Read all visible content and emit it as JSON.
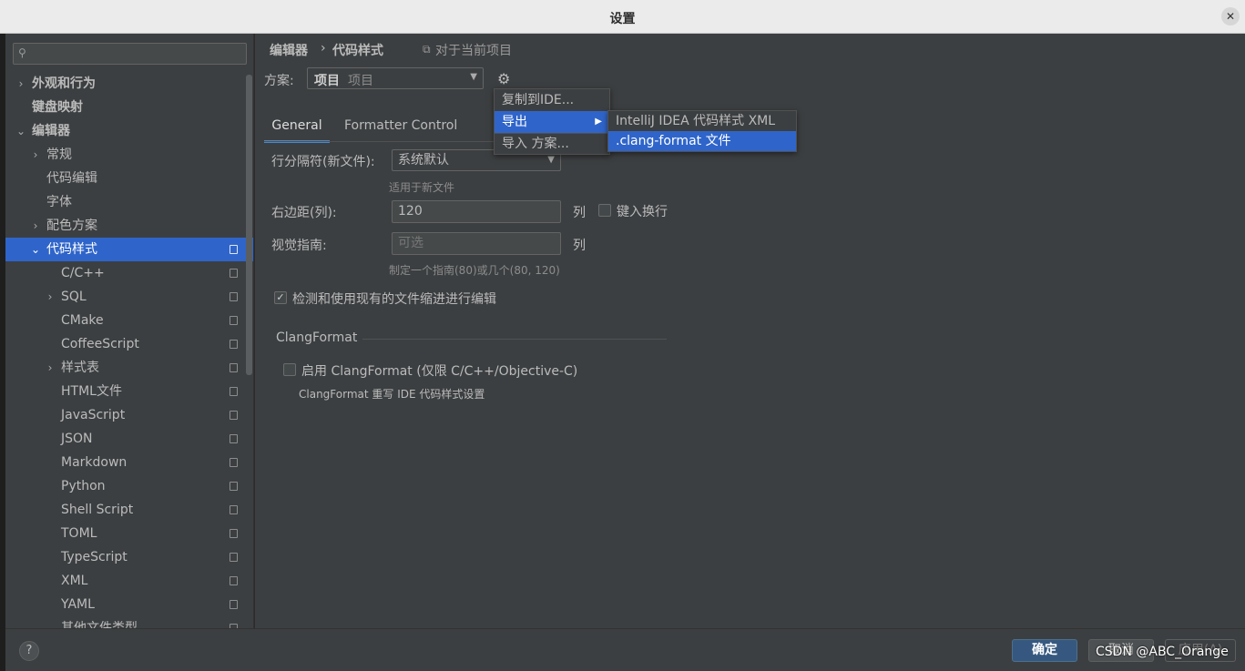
{
  "window": {
    "title": "设置",
    "close_icon": "close-icon"
  },
  "sidebar": {
    "search_placeholder": "",
    "items": [
      {
        "label": "外观和行为",
        "arrow": "›",
        "bold": true
      },
      {
        "label": "键盘映射",
        "arrow": "",
        "bold": true
      },
      {
        "label": "编辑器",
        "arrow": "⌄",
        "bold": true
      },
      {
        "label": "常规",
        "arrow": "›"
      },
      {
        "label": "代码编辑",
        "arrow": ""
      },
      {
        "label": "字体",
        "arrow": ""
      },
      {
        "label": "配色方案",
        "arrow": "›"
      },
      {
        "label": "代码样式",
        "arrow": "⌄",
        "selected": true
      },
      {
        "label": "C/C++",
        "arrow": ""
      },
      {
        "label": "SQL",
        "arrow": "›"
      },
      {
        "label": "CMake",
        "arrow": ""
      },
      {
        "label": "CoffeeScript",
        "arrow": ""
      },
      {
        "label": "样式表",
        "arrow": "›"
      },
      {
        "label": "HTML文件",
        "arrow": ""
      },
      {
        "label": "JavaScript",
        "arrow": ""
      },
      {
        "label": "JSON",
        "arrow": ""
      },
      {
        "label": "Markdown",
        "arrow": ""
      },
      {
        "label": "Python",
        "arrow": ""
      },
      {
        "label": "Shell Script",
        "arrow": ""
      },
      {
        "label": "TOML",
        "arrow": ""
      },
      {
        "label": "TypeScript",
        "arrow": ""
      },
      {
        "label": "XML",
        "arrow": ""
      },
      {
        "label": "YAML",
        "arrow": ""
      },
      {
        "label": "其他文件类型",
        "arrow": ""
      }
    ]
  },
  "breadcrumb": {
    "root": "编辑器",
    "separator": "›",
    "current": "代码样式",
    "scope": "对于当前项目"
  },
  "scheme": {
    "label": "方案:",
    "value": "项目",
    "value_sub": "项目",
    "gear_icon": "gear-icon"
  },
  "tabs": [
    {
      "label": "General",
      "active": true
    },
    {
      "label": "Formatter Control"
    }
  ],
  "general": {
    "line_separator_label": "行分隔符(新文件):",
    "line_separator_value": "系统默认",
    "line_separator_hint": "适用于新文件",
    "right_margin_label": "右边距(列):",
    "right_margin_value": "120",
    "right_margin_unit": "列",
    "wrap_on_typing_label": "键入换行",
    "visual_guides_label": "视觉指南:",
    "visual_guides_placeholder": "可选",
    "visual_guides_unit": "列",
    "visual_guides_hint": "制定一个指南(80)或几个(80, 120)",
    "detect_indent_label": "检测和使用现有的文件缩进进行编辑",
    "detect_indent_checked": true
  },
  "clangformat": {
    "section_title": "ClangFormat",
    "enable_label": "启用 ClangFormat (仅限 C/C++/Objective-C)",
    "enable_checked": false,
    "hint": "ClangFormat 重写 IDE 代码样式设置"
  },
  "gear_menu": {
    "items": [
      {
        "label": "复制到IDE..."
      },
      {
        "label": "导出",
        "active": true,
        "submenu": true
      },
      {
        "label": "导入 方案..."
      }
    ]
  },
  "export_submenu": {
    "items": [
      {
        "label": "IntelliJ IDEA 代码样式 XML"
      },
      {
        "label": ".clang-format 文件",
        "active": true
      }
    ]
  },
  "footer": {
    "help_label": "?",
    "ok_label": "确定",
    "cancel_label": "取消",
    "apply_label": "应用(A)"
  },
  "watermark": "CSDN @ABC_Orange"
}
